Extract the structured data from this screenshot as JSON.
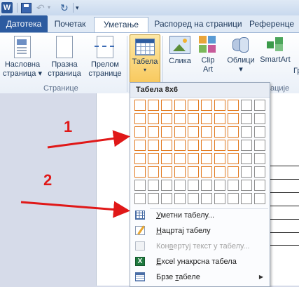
{
  "quick_access": {
    "app_icon": "word-icon",
    "app_letter": "W",
    "buttons": [
      "save-icon",
      "undo-icon",
      "redo-icon",
      "customize-arrow-icon"
    ]
  },
  "tabs": [
    {
      "label": "Датотека",
      "active": false
    },
    {
      "label": "Почетак",
      "active": false
    },
    {
      "label": "Уметање",
      "active": true
    },
    {
      "label": "Распоред на страници",
      "active": false
    },
    {
      "label": "Референце",
      "active": false
    }
  ],
  "ribbon": {
    "pages_group": {
      "label": "Странице",
      "cover": [
        "Насловна",
        "страница"
      ],
      "blank": [
        "Празна",
        "страница"
      ],
      "break": [
        "Прелом",
        "странице"
      ]
    },
    "table": {
      "label": "Табела"
    },
    "picture": {
      "label": "Слика"
    },
    "clipart": [
      "Clip",
      "Art"
    ],
    "shapes": {
      "label": "Облици"
    },
    "smartart": {
      "label": "SmartArt"
    },
    "chart_partial": "Гр",
    "illustrations_partial": "ације"
  },
  "menu": {
    "header": "Табела 8x6",
    "grid_cols": 10,
    "grid_rows": 8,
    "selected_cols": 8,
    "selected_rows": 6,
    "items": [
      {
        "prefix": "",
        "key": "У",
        "rest": "метни табелу...",
        "icon": "insert-table-icon",
        "disabled": false
      },
      {
        "prefix": "",
        "key": "Н",
        "rest": "ацртај табелу",
        "icon": "draw-table-icon",
        "disabled": false
      },
      {
        "prefix": "Кон",
        "key": "в",
        "rest": "ертуј текст у табелу...",
        "icon": "convert-text-icon",
        "disabled": true
      },
      {
        "prefix": "",
        "key": "E",
        "rest": "xcel унакрсна табела",
        "icon": "excel-icon",
        "disabled": false
      },
      {
        "prefix": "Брзе ",
        "key": "т",
        "rest": "абеле",
        "icon": "quick-tables-icon",
        "disabled": false,
        "submenu": true
      }
    ]
  },
  "annotations": {
    "label_1": "1",
    "label_2": "2",
    "color": "#e01818"
  }
}
